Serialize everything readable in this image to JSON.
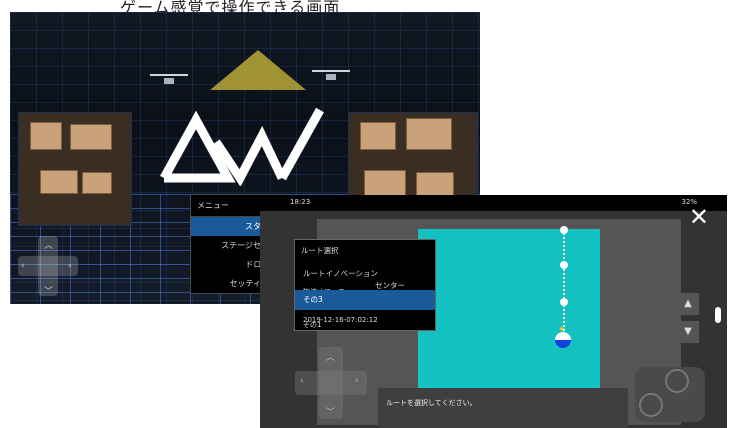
{
  "caption": "ゲーム感覚で操作できる画面",
  "title_screen": {
    "menu_title": "メニュー",
    "menu_items": [
      "スタート",
      "ステージセレク",
      "ドローン",
      "セッティング"
    ],
    "selected_index": 0
  },
  "route_screen": {
    "status_time": "18:23",
    "status_right": "32%",
    "menu_title": "ルート選択",
    "menu_rows": [
      "ルートイノベーション",
      "センター",
      "物流オフィス",
      "その3",
      "2019-12-16-07:02:12",
      "その1"
    ],
    "selected_row": "その3",
    "message": "ルートを選択してください。",
    "close_label": "✕",
    "up_label": "▲",
    "down_label": "▼",
    "colors": {
      "accent": "#1a5a98",
      "teal": "#14c1c1"
    }
  }
}
